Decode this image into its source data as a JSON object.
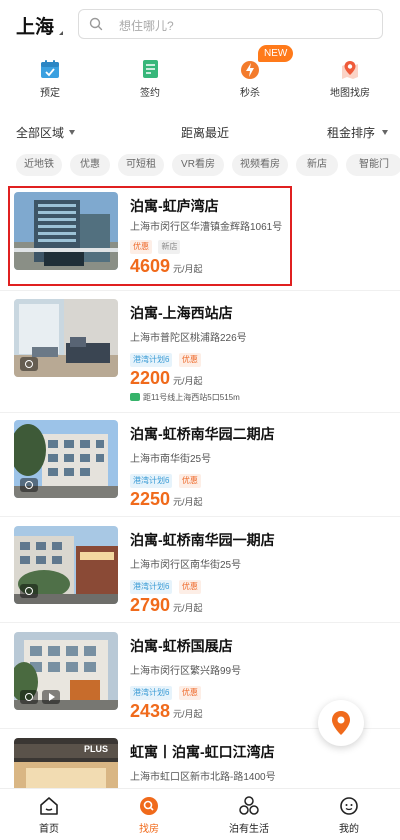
{
  "header": {
    "city": "上海",
    "search_placeholder": "想住哪儿?"
  },
  "quick_nav": {
    "items": [
      {
        "label": "预定",
        "icon": "calendar-icon"
      },
      {
        "label": "签约",
        "icon": "contract-icon"
      },
      {
        "label": "秒杀",
        "icon": "flash-sale-icon"
      },
      {
        "label": "地图找房",
        "icon": "map-pin-icon"
      }
    ],
    "new_badge": "NEW"
  },
  "filters": {
    "area": "全部区域",
    "distance": "距离最近",
    "rent": "租金排序"
  },
  "tags": [
    "近地铁",
    "优惠",
    "可短租",
    "VR看房",
    "视频看房",
    "新店",
    "智能门"
  ],
  "listings": [
    {
      "title": "泊寓-虹庐湾店",
      "address": "上海市闵行区华漕镇金辉路1061号",
      "badges": [
        "优惠",
        "新店"
      ],
      "price": "4609",
      "unit": "元/月起"
    },
    {
      "title": "泊寓-上海西站店",
      "address": "上海市普陀区桃浦路226号",
      "badges": [
        "港湾计划6",
        "优惠"
      ],
      "price": "2200",
      "unit": "元/月起",
      "metro": "距11号线上海西站5口515m"
    },
    {
      "title": "泊寓-虹桥南华园二期店",
      "address": "上海市南华街25号",
      "badges": [
        "港湾计划6",
        "优惠"
      ],
      "price": "2250",
      "unit": "元/月起"
    },
    {
      "title": "泊寓-虹桥南华园一期店",
      "address": "上海市闵行区南华街25号",
      "badges": [
        "港湾计划6",
        "优惠"
      ],
      "price": "2790",
      "unit": "元/月起"
    },
    {
      "title": "泊寓-虹桥国展店",
      "address": "上海市闵行区繁兴路99号",
      "badges": [
        "港湾计划6",
        "优惠"
      ],
      "price": "2438",
      "unit": "元/月起"
    },
    {
      "title": "虹寓丨泊寓-虹口江湾店",
      "address": "上海市虹口区新市北路-路1400号",
      "badges": [],
      "price": "",
      "unit": "",
      "photo_sign": "PLUS"
    }
  ],
  "tabbar": {
    "items": [
      {
        "label": "首页",
        "icon": "home-icon"
      },
      {
        "label": "找房",
        "icon": "find-house-icon"
      },
      {
        "label": "泊有生活",
        "icon": "life-icon"
      },
      {
        "label": "我的",
        "icon": "profile-icon"
      }
    ],
    "active_index": 1
  },
  "colors": {
    "accent": "#f06a1b",
    "highlight_border": "#e02020",
    "badge_blue": "#3a9bd5",
    "badge_orange": "#ee6a2a"
  }
}
